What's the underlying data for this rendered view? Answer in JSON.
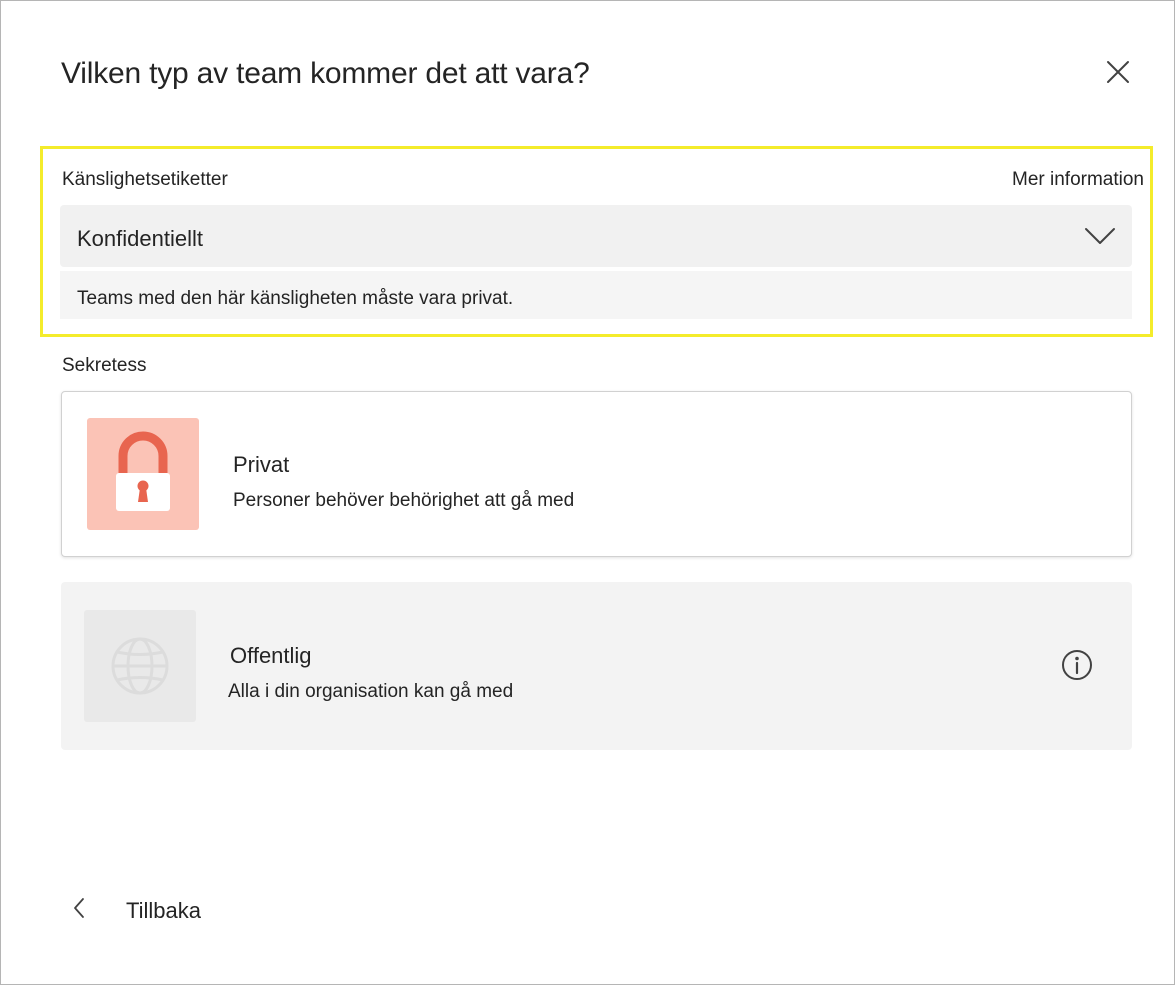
{
  "dialog": {
    "title": "Vilken typ av team kommer det att vara?",
    "close_icon": "close-icon"
  },
  "sensitivity": {
    "label": "Känslighetsetiketter",
    "more_info": "Mer information",
    "selected_value": "Konfidentiellt",
    "note": "Teams med den här känsligheten måste vara privat.",
    "chevron_icon": "chevron-down-icon",
    "highlight_color": "#f4ec2b"
  },
  "privacy": {
    "label": "Sekretess",
    "options": [
      {
        "title": "Privat",
        "description": "Personer behöver behörighet att gå med",
        "icon": "lock-icon",
        "icon_bg": "#fbc3b6",
        "icon_color": "#e8654f",
        "selected": true
      },
      {
        "title": "Offentlig",
        "description": "Alla i din organisation kan gå med",
        "icon": "globe-icon",
        "icon_bg": "#e9e9e9",
        "disabled": true,
        "info_icon": "info-icon"
      }
    ]
  },
  "footer": {
    "back_label": "Tillbaka",
    "back_icon": "chevron-left-icon"
  }
}
